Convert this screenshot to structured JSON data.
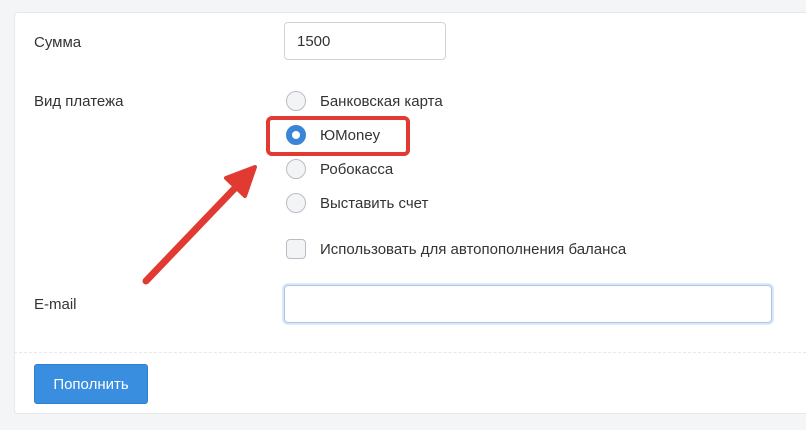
{
  "form": {
    "amount_label": "Сумма",
    "amount_value": "1500",
    "payment_type_label": "Вид платежа",
    "payment_options": [
      {
        "label": "Банковская карта",
        "checked": false
      },
      {
        "label": "ЮMoney",
        "checked": true
      },
      {
        "label": "Робокасса",
        "checked": false
      },
      {
        "label": "Выставить счет",
        "checked": false
      }
    ],
    "autofill_checkbox_label": "Использовать для автопополнения баланса",
    "autofill_checked": false,
    "email_label": "E-mail",
    "email_value": "",
    "submit_label": "Пополнить"
  },
  "annotation": {
    "highlight_color": "#e03a32",
    "arrow_color": "#e03a32",
    "highlighted_option": "ЮMoney"
  },
  "colors": {
    "accent": "#3a8ee0",
    "radio_checked": "#3a86d6"
  }
}
